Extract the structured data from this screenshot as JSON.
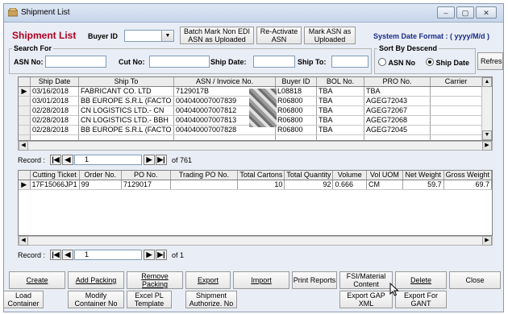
{
  "window": {
    "title": "Shipment List"
  },
  "header": {
    "app_label": "Shipment List",
    "buyer_label": "Buyer ID",
    "buyer_value": "",
    "btn_batch_mark": "Batch Mark Non EDI ASN as Uploaded",
    "btn_reactivate": "Re-Activate ASN",
    "btn_mark_uploaded": "Mark ASN as Uploaded",
    "date_format": "System Date Format : ( yyyy/M/d )"
  },
  "search": {
    "legend": "Search For",
    "asn_label": "ASN No:",
    "cut_label": "Cut No:",
    "ship_date_label": "Ship Date:",
    "ship_to_label": "Ship To:"
  },
  "sort": {
    "legend": "Sort By Descend",
    "asn_option": "ASN No",
    "ship_date_option": "Ship Date",
    "refresh": "Refresh"
  },
  "top_grid": {
    "columns": [
      "Ship Date",
      "Ship To",
      "ASN / Invoice No.",
      "Buyer ID",
      "BOL No.",
      "PRO No.",
      "Carrier"
    ],
    "rows": [
      [
        "03/16/2018",
        "FABRICANT CO. LTD",
        "7129017B",
        "L08818",
        "TBA",
        "TBA",
        ""
      ],
      [
        "03/01/2018",
        "BB EUROPE S.R.L (FACTO",
        "004040007007839",
        "R06800",
        "TBA",
        "AGEG72043",
        ""
      ],
      [
        "02/28/2018",
        "CN LOGISTICS LTD.- CN",
        "004040007007812",
        "R06800",
        "TBA",
        "AGEG72067",
        ""
      ],
      [
        "02/28/2018",
        "CN LOGISTICS LTD.- BBH",
        "004040007007813",
        "R06800",
        "TBA",
        "AGEG72068",
        ""
      ],
      [
        "02/28/2018",
        "BB EUROPE S.R.L (FACTO",
        "004040007007828",
        "R06800",
        "TBA",
        "AGEG72045",
        ""
      ]
    ]
  },
  "top_nav": {
    "label": "Record :",
    "current": "1",
    "total": "of 761"
  },
  "bottom_grid": {
    "columns": [
      "Cutting Ticket",
      "Order No.",
      "PO No.",
      "Trading PO No.",
      "Total Cartons",
      "Total Quantity",
      "Volume",
      "Vol UOM",
      "Net Weight",
      "Gross Weight"
    ],
    "rows": [
      [
        "17F15066JP1",
        "99",
        "7129017",
        "",
        "10",
        "92",
        "0.666",
        "CM",
        "59.7",
        "69.7"
      ]
    ]
  },
  "bottom_nav": {
    "label": "Record :",
    "current": "1",
    "total": "of 1"
  },
  "actions_row1": {
    "create": "Create",
    "add_packing": "Add Packing",
    "remove_packing": "Remove Packing",
    "export": "Export",
    "import": "Import",
    "print_reports": "Print Reports",
    "fsi_material": "FSI/Material Content",
    "delete": "Delete",
    "close": "Close"
  },
  "actions_row2": {
    "load_container": "Load Container",
    "modify_container": "Modify Container No",
    "excel_pl": "Excel PL Template",
    "shipment_authorize": "Shipment Authorize. No",
    "export_gap": "Export GAP XML",
    "export_gant": "Export For GANT"
  }
}
